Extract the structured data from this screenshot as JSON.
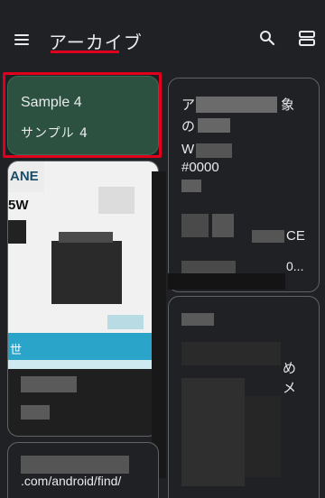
{
  "header": {
    "title": "アーカイブ"
  },
  "icons": {
    "menu": "menu-icon",
    "search": "search-icon",
    "layout": "view-layout-icon"
  },
  "notes": {
    "selected": {
      "title": "Sample 4",
      "body": "サンプル 4"
    },
    "right1": {
      "fragment_1": "ア",
      "fragment_2": "象",
      "fragment_3": "の",
      "fragment_4": "W",
      "fragment_5": "#0000",
      "fragment_6": "CE",
      "fragment_7": "0..."
    },
    "image_note": {
      "fragment_1": "ANE",
      "fragment_2": "5W",
      "fragment_3": "世"
    },
    "right2": {
      "fragment_1": "め",
      "fragment_2": "メ"
    },
    "bottom": {
      "fragment_1": ".com/android/find/"
    }
  },
  "colors": {
    "accent_red": "#e0001e",
    "selected_note_bg": "#2d5140",
    "background": "#202124"
  }
}
